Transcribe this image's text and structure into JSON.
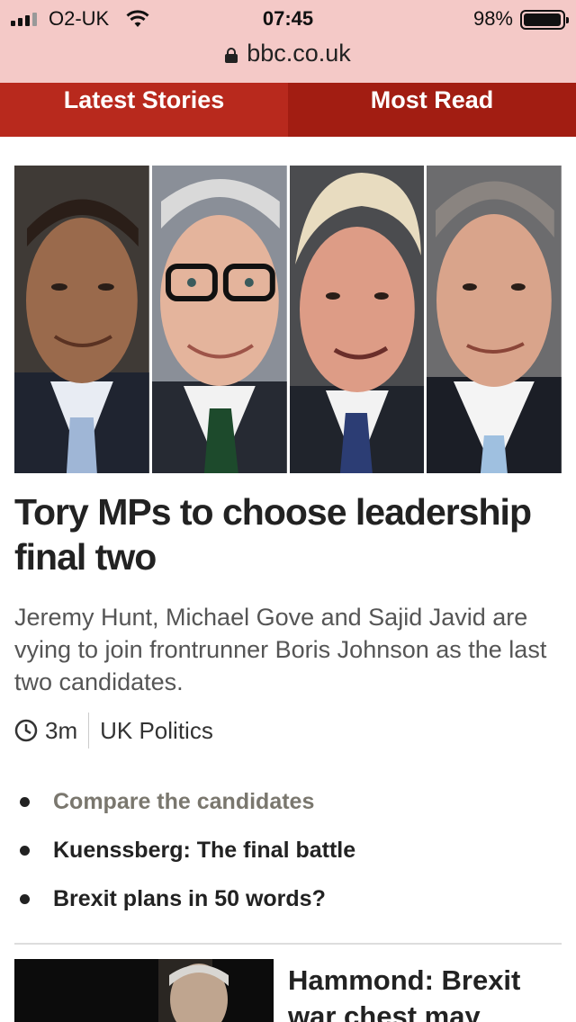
{
  "status_bar": {
    "carrier": "O2-UK",
    "time": "07:45",
    "battery_percent": "98%",
    "battery_level": 0.98,
    "url": "bbc.co.uk",
    "background_color": "#f4c9c7"
  },
  "tabs": [
    {
      "label": "Latest Stories",
      "color": "#b8291d"
    },
    {
      "label": "Most Read",
      "color": "#a21d12"
    }
  ],
  "story": {
    "headline": "Tory MPs to choose leadership final two",
    "summary": "Jeremy Hunt, Michael Gove and Sajid Javid are vying to join frontrunner Boris Johnson as the last two candidates.",
    "time_ago": "3m",
    "section": "UK Politics",
    "related": [
      {
        "label": "Compare the candidates",
        "visited": true
      },
      {
        "label": "Kuenssberg: The final battle",
        "visited": false
      },
      {
        "label": "Brexit plans in 50 words?",
        "visited": false
      }
    ]
  },
  "next_story": {
    "headline": "Hammond: Brexit war chest may"
  }
}
